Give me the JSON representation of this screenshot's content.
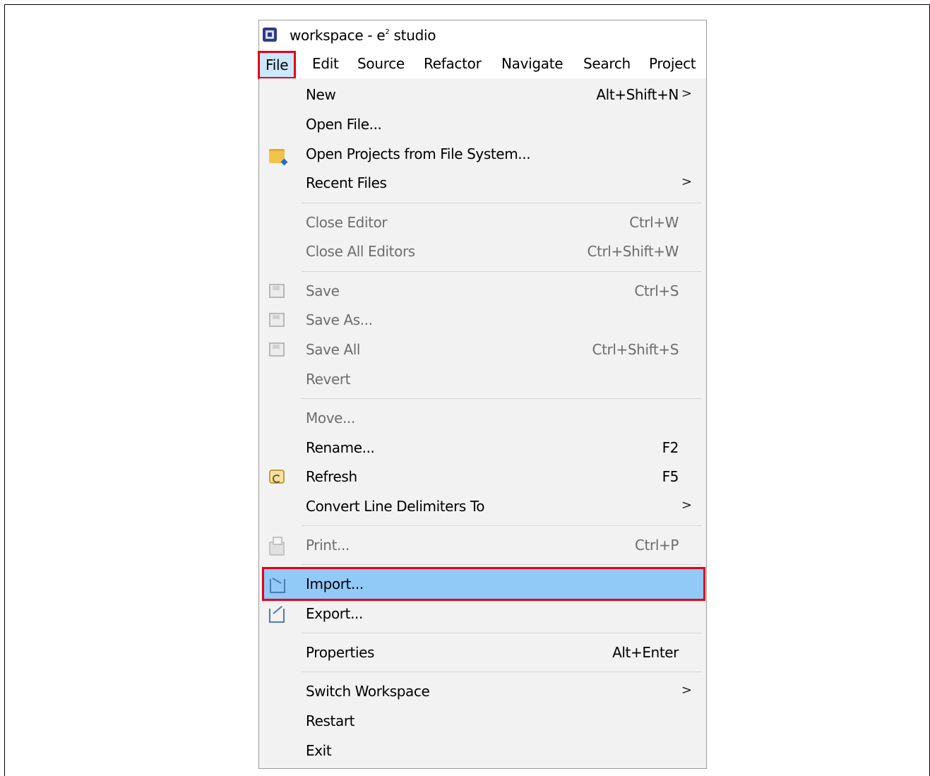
{
  "window": {
    "title_prefix": "workspace - e",
    "title_sup": "2",
    "title_suffix": " studio"
  },
  "menubar": {
    "items": [
      "File",
      "Edit",
      "Source",
      "Refactor",
      "Navigate",
      "Search",
      "Project"
    ]
  },
  "file_menu": {
    "new": {
      "label": "New",
      "shortcut": "Alt+Shift+N",
      "arrow": ">"
    },
    "open_file": {
      "label": "Open File..."
    },
    "open_projects": {
      "label": "Open Projects from File System..."
    },
    "recent_files": {
      "label": "Recent Files",
      "arrow": ">"
    },
    "close_editor": {
      "label": "Close Editor",
      "shortcut": "Ctrl+W"
    },
    "close_all": {
      "label": "Close All Editors",
      "shortcut": "Ctrl+Shift+W"
    },
    "save": {
      "label": "Save",
      "shortcut": "Ctrl+S"
    },
    "save_as": {
      "label": "Save As..."
    },
    "save_all": {
      "label": "Save All",
      "shortcut": "Ctrl+Shift+S"
    },
    "revert": {
      "label": "Revert"
    },
    "move": {
      "label": "Move..."
    },
    "rename": {
      "label": "Rename...",
      "shortcut": "F2"
    },
    "refresh": {
      "label": "Refresh",
      "shortcut": "F5"
    },
    "convert": {
      "label": "Convert Line Delimiters To",
      "arrow": ">"
    },
    "print": {
      "label": "Print...",
      "shortcut": "Ctrl+P"
    },
    "import": {
      "label": "Import..."
    },
    "export": {
      "label": "Export..."
    },
    "properties": {
      "label": "Properties",
      "shortcut": "Alt+Enter"
    },
    "switch_ws": {
      "label": "Switch Workspace",
      "arrow": ">"
    },
    "restart": {
      "label": "Restart"
    },
    "exit": {
      "label": "Exit"
    }
  },
  "colors": {
    "highlight": "#91c9f7",
    "annotation_red": "#e2001a",
    "menu_bg": "#f2f2f2",
    "disabled_text": "#6d6d6d"
  }
}
